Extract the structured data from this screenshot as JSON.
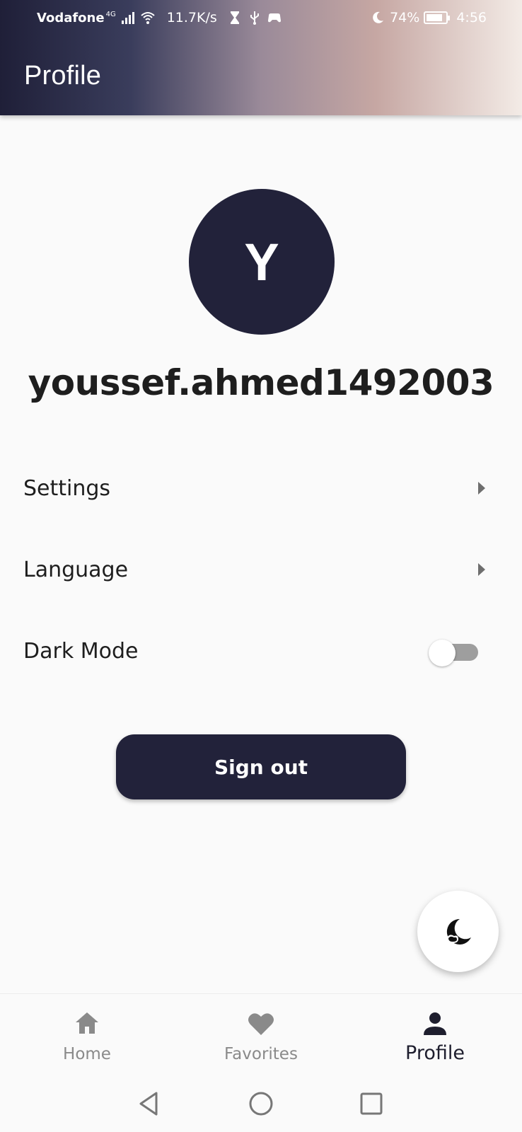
{
  "status_bar": {
    "carrier": "Vodafone",
    "network_type": "4G",
    "speed": "11.7K/s",
    "battery": "74%",
    "time": "4:56",
    "icons": [
      "signal-icon",
      "wifi-icon",
      "hourglass-icon",
      "usb-icon",
      "game-icon",
      "moon-icon",
      "battery-icon"
    ]
  },
  "app_bar": {
    "title": "Profile"
  },
  "profile": {
    "avatar_initial": "Y",
    "username": "youssef.ahmed1492003"
  },
  "menu": {
    "settings_label": "Settings",
    "language_label": "Language",
    "dark_mode_label": "Dark Mode",
    "dark_mode_on": false
  },
  "sign_out_label": "Sign out",
  "fab": {
    "icon": "moon-icon"
  },
  "bottom_nav": {
    "home_label": "Home",
    "favorites_label": "Favorites",
    "profile_label": "Profile",
    "selected": "Profile"
  },
  "colors": {
    "primary": "#22223a",
    "background": "#fafafa",
    "inactive": "#8a8a8a"
  }
}
